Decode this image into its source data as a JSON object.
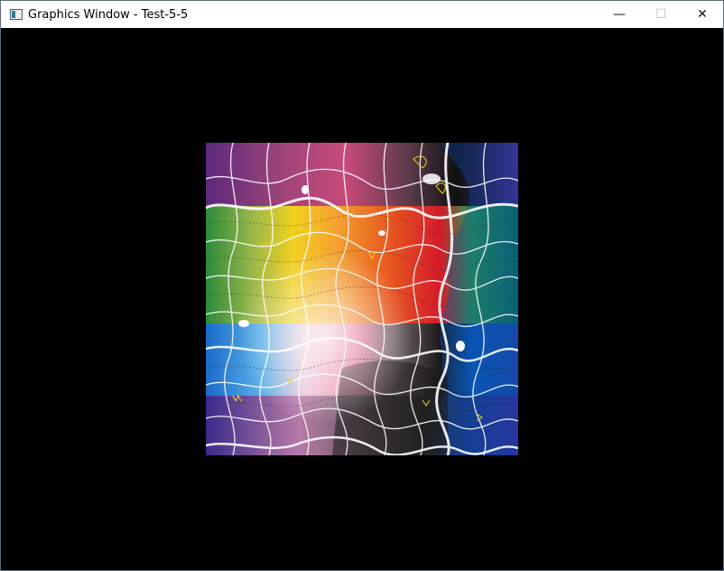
{
  "window": {
    "title": "Graphics Window - Test-5-5",
    "controls": {
      "minimize": "—",
      "maximize": "☐",
      "close": "✕"
    }
  },
  "icons": {
    "app": "app-window-icon",
    "minimize": "minimize-icon",
    "maximize": "maximize-icon",
    "close": "close-icon"
  },
  "colors": {
    "background": "#000000",
    "titlebar": "#ffffff"
  }
}
